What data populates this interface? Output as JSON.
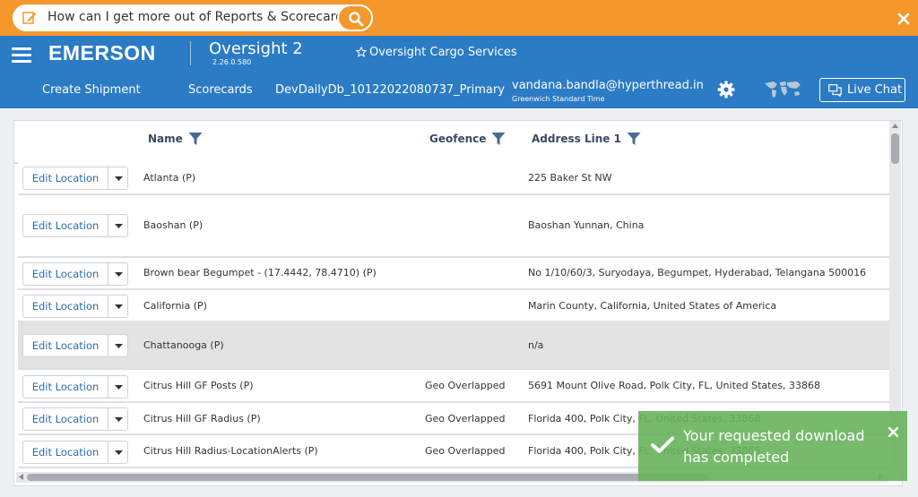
{
  "search": {
    "question": "How can I get more out of Reports & Scorecards?"
  },
  "header": {
    "brand": "EMERSON",
    "brand_tm": ".",
    "app_name": "Oversight 2",
    "version": "2.26.0.580",
    "cargo": "Oversight Cargo Services",
    "nav": {
      "create_shipment": "Create Shipment",
      "scorecards": "Scorecards",
      "database": "DevDailyDb_10122022080737_Primary"
    },
    "user_email": "vandana.bandla@hyperthread.in",
    "timezone": "Greenwich Standard Time",
    "live_chat": "Live Chat"
  },
  "table": {
    "columns": {
      "name": "Name",
      "geofence": "Geofence",
      "address": "Address Line 1"
    },
    "edit_label": "Edit Location",
    "rows": [
      {
        "name": "Atlanta (P)",
        "geofence": "",
        "address": "225 Baker St NW"
      },
      {
        "name": "Baoshan (P)",
        "geofence": "",
        "address": "Baoshan Yunnan, China"
      },
      {
        "name": "Brown bear Begumpet - (17.4442, 78.4710) (P)",
        "geofence": "",
        "address": "No 1/10/60/3, Suryodaya, Begumpet, Hyderabad, Telangana 500016"
      },
      {
        "name": "California (P)",
        "geofence": "",
        "address": "Marin County, California, United States of America"
      },
      {
        "name": "Chattanooga (P)",
        "geofence": "",
        "address": "n/a"
      },
      {
        "name": "Citrus Hill GF Posts (P)",
        "geofence": "Geo Overlapped",
        "address": "5691 Mount Olive Road, Polk City, FL, United States, 33868"
      },
      {
        "name": "Citrus Hill GF Radius (P)",
        "geofence": "Geo Overlapped",
        "address": "Florida 400, Polk City, FL, United States, 33868"
      },
      {
        "name": "Citrus Hill Radius-LocationAlerts (P)",
        "geofence": "Geo Overlapped",
        "address": "Florida 400, Polk City, FL, United States, 33868"
      }
    ]
  },
  "toast": {
    "line1": "Your requested download",
    "line2": "has completed"
  },
  "colors": {
    "banner": "#f5982b",
    "header": "#2b7bc5",
    "toast": "#68b25c"
  }
}
